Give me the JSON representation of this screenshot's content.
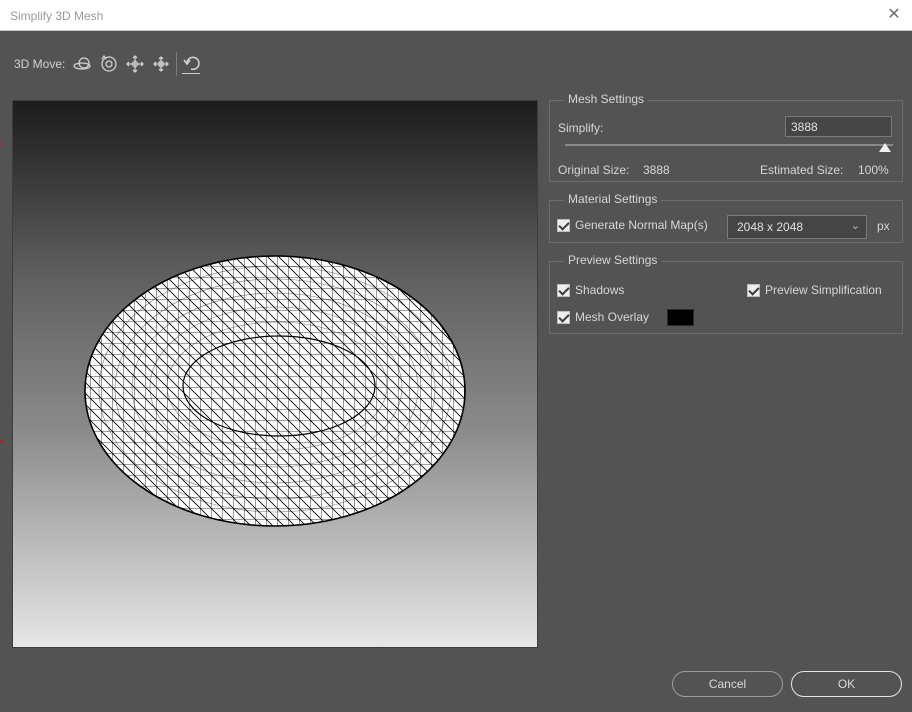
{
  "window": {
    "title": "Simplify 3D Mesh",
    "close_glyph": "✕"
  },
  "toolbar": {
    "label": "3D Move:",
    "tools": [
      {
        "name": "orbit-3d-icon"
      },
      {
        "name": "roll-3d-icon"
      },
      {
        "name": "pan-3d-icon"
      },
      {
        "name": "slide-3d-icon"
      },
      {
        "name": "reset-view-icon"
      }
    ]
  },
  "mesh_settings": {
    "title": "Mesh Settings",
    "simplify_label": "Simplify:",
    "simplify_value": "3888",
    "slider_fraction": 1.0,
    "original_size_label": "Original Size:",
    "original_size_value": "3888",
    "estimated_size_label": "Estimated Size:",
    "estimated_size_value": "100%"
  },
  "material_settings": {
    "title": "Material Settings",
    "generate_normal_label": "Generate Normal Map(s)",
    "generate_normal_checked": true,
    "size_option": "2048 x 2048",
    "unit": "px"
  },
  "preview_settings": {
    "title": "Preview Settings",
    "shadows_label": "Shadows",
    "shadows_checked": true,
    "preview_simplification_label": "Preview Simplification",
    "preview_simplification_checked": true,
    "mesh_overlay_label": "Mesh Overlay",
    "mesh_overlay_checked": true,
    "mesh_overlay_color": "#000000"
  },
  "buttons": {
    "cancel": "Cancel",
    "ok": "OK"
  }
}
